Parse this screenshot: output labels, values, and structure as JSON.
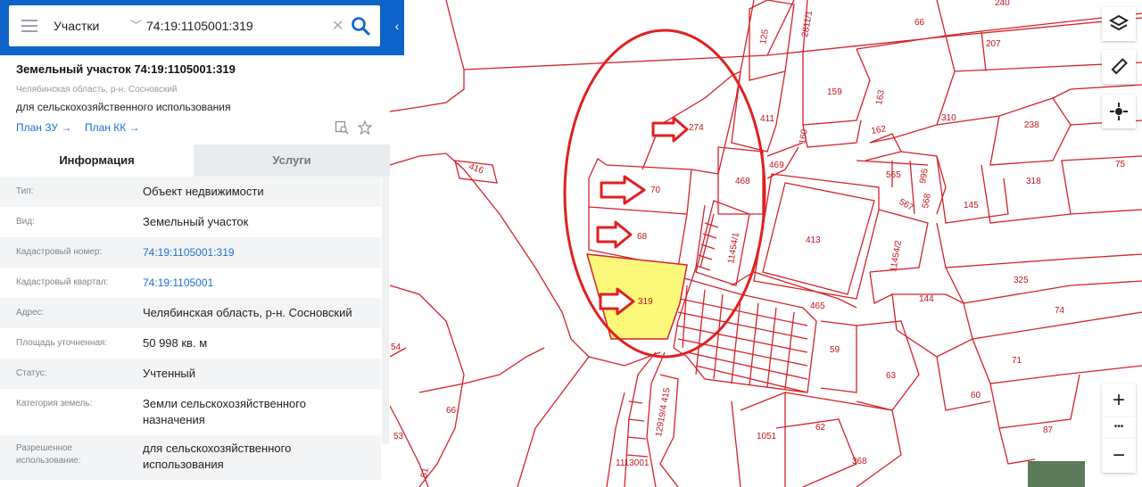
{
  "search": {
    "type_label": "Участки",
    "query": "74:19:1105001:319",
    "clear_symbol": "✕"
  },
  "parcel": {
    "title": "Земельный участок 74:19:1105001:319",
    "region": "Челябинская область, р-н. Сосновский",
    "usage": "для сельскохозяйственного использования",
    "plan_zu": "План ЗУ →",
    "plan_kk": "План КК →"
  },
  "tabs": {
    "info": "Информация",
    "services": "Услуги"
  },
  "details": [
    {
      "label": "Тип:",
      "value": "Объект недвижимости"
    },
    {
      "label": "Вид:",
      "value": "Земельный участок"
    },
    {
      "label": "Кадастровый номер:",
      "value": "74:19:1105001:319"
    },
    {
      "label": "Кадастровый квартал:",
      "value": "74:19:1105001"
    },
    {
      "label": "Адрес:",
      "value": "Челябинская область, р-н. Сосновский"
    },
    {
      "label": "Площадь уточненная:",
      "value": "50 998 кв. м"
    },
    {
      "label": "Статус:",
      "value": "Учтенный"
    },
    {
      "label": "Категория земель:",
      "value": "Земли сельскохозяйственного назначения"
    },
    {
      "label": "Разрешенное использование:",
      "value": "для сельскохозяйственного использования"
    }
  ],
  "map": {
    "labels": [
      "240",
      "66",
      "207",
      "125",
      "2811/1",
      "159",
      "163",
      "411",
      "310",
      "238",
      "274",
      "162",
      "160",
      "469",
      "565",
      "995",
      "75",
      "416",
      "468",
      "318",
      "70",
      "567",
      "568",
      "145",
      "413",
      "68",
      "11454/1",
      "11454/2",
      "325",
      "319",
      "144",
      "465",
      "74",
      "54",
      "59",
      "71",
      "63",
      "60",
      "66",
      "87",
      "12919/4 415",
      "1051",
      "62",
      "53",
      "368",
      "1113001",
      "51"
    ],
    "controls": {
      "zoom_in": "+",
      "more": "•••",
      "zoom_out": "−"
    }
  },
  "colors": {
    "brand": "#0e63c9",
    "link": "#1a6fd6",
    "parcel_border": "#d4222a",
    "selected_fill": "#fbf87a",
    "annotation": "#e0201f"
  },
  "icons": [
    "menu-icon",
    "chevron-down-icon",
    "clear-icon",
    "search-icon",
    "collapse-icon",
    "plan-search-icon",
    "star-icon",
    "layers-icon",
    "ruler-icon",
    "locate-icon"
  ]
}
